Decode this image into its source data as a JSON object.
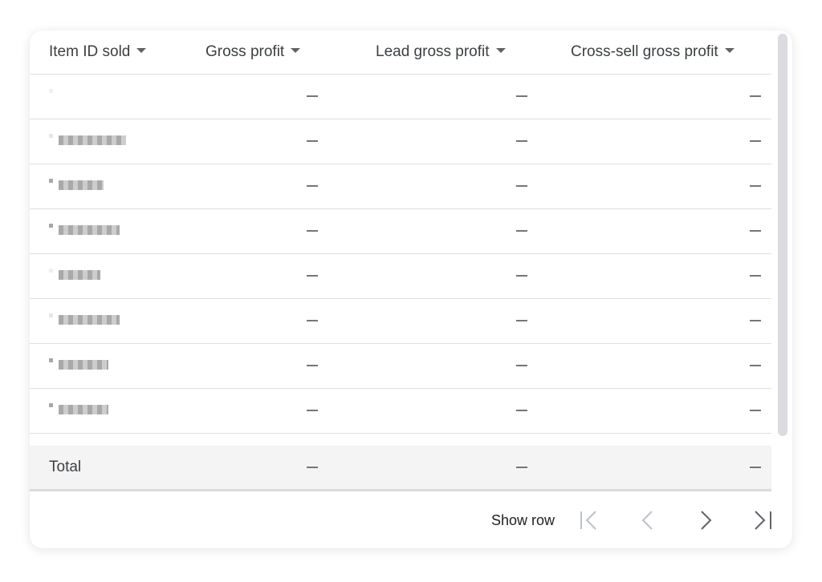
{
  "table": {
    "columns": [
      {
        "label": "Item ID sold",
        "sort_icon": "arrow-drop-down-icon"
      },
      {
        "label": "Gross profit",
        "sort_icon": "arrow-drop-down-icon"
      },
      {
        "label": "Lead gross profit",
        "sort_icon": "arrow-drop-down-icon"
      },
      {
        "label": "Cross-sell gross profit",
        "sort_icon": "arrow-drop-down-icon"
      }
    ],
    "rows": [
      {
        "item_id": "[redacted]",
        "gross_profit": "—",
        "lead_gross_profit": "—",
        "cross_sell_gross_profit": "—"
      },
      {
        "item_id": "[redacted]",
        "gross_profit": "—",
        "lead_gross_profit": "—",
        "cross_sell_gross_profit": "—"
      },
      {
        "item_id": "[redacted]",
        "gross_profit": "—",
        "lead_gross_profit": "—",
        "cross_sell_gross_profit": "—"
      },
      {
        "item_id": "[redacted]",
        "gross_profit": "—",
        "lead_gross_profit": "—",
        "cross_sell_gross_profit": "—"
      },
      {
        "item_id": "[redacted]",
        "gross_profit": "—",
        "lead_gross_profit": "—",
        "cross_sell_gross_profit": "—"
      },
      {
        "item_id": "[redacted]",
        "gross_profit": "—",
        "lead_gross_profit": "—",
        "cross_sell_gross_profit": "—"
      },
      {
        "item_id": "[redacted]",
        "gross_profit": "—",
        "lead_gross_profit": "—",
        "cross_sell_gross_profit": "—"
      },
      {
        "item_id": "[redacted]",
        "gross_profit": "—",
        "lead_gross_profit": "—",
        "cross_sell_gross_profit": "—"
      }
    ],
    "total": {
      "label": "Total",
      "gross_profit": "—",
      "lead_gross_profit": "—",
      "cross_sell_gross_profit": "—"
    }
  },
  "footer": {
    "show_row_label": "Show row",
    "buttons": [
      {
        "name": "first-page",
        "icon": "first-page-icon",
        "enabled": false
      },
      {
        "name": "previous-page",
        "icon": "chevron-left-icon",
        "enabled": false
      },
      {
        "name": "next-page",
        "icon": "chevron-right-icon",
        "enabled": true
      },
      {
        "name": "last-page",
        "icon": "last-page-icon",
        "enabled": true
      }
    ]
  },
  "colors": {
    "text": "#3c4043",
    "divider": "#dcdfe4",
    "total_bg": "#f4f4f4",
    "scrollbar": "#dadce0",
    "icon_enabled": "#5f6368",
    "icon_disabled": "#bdc1c6"
  }
}
